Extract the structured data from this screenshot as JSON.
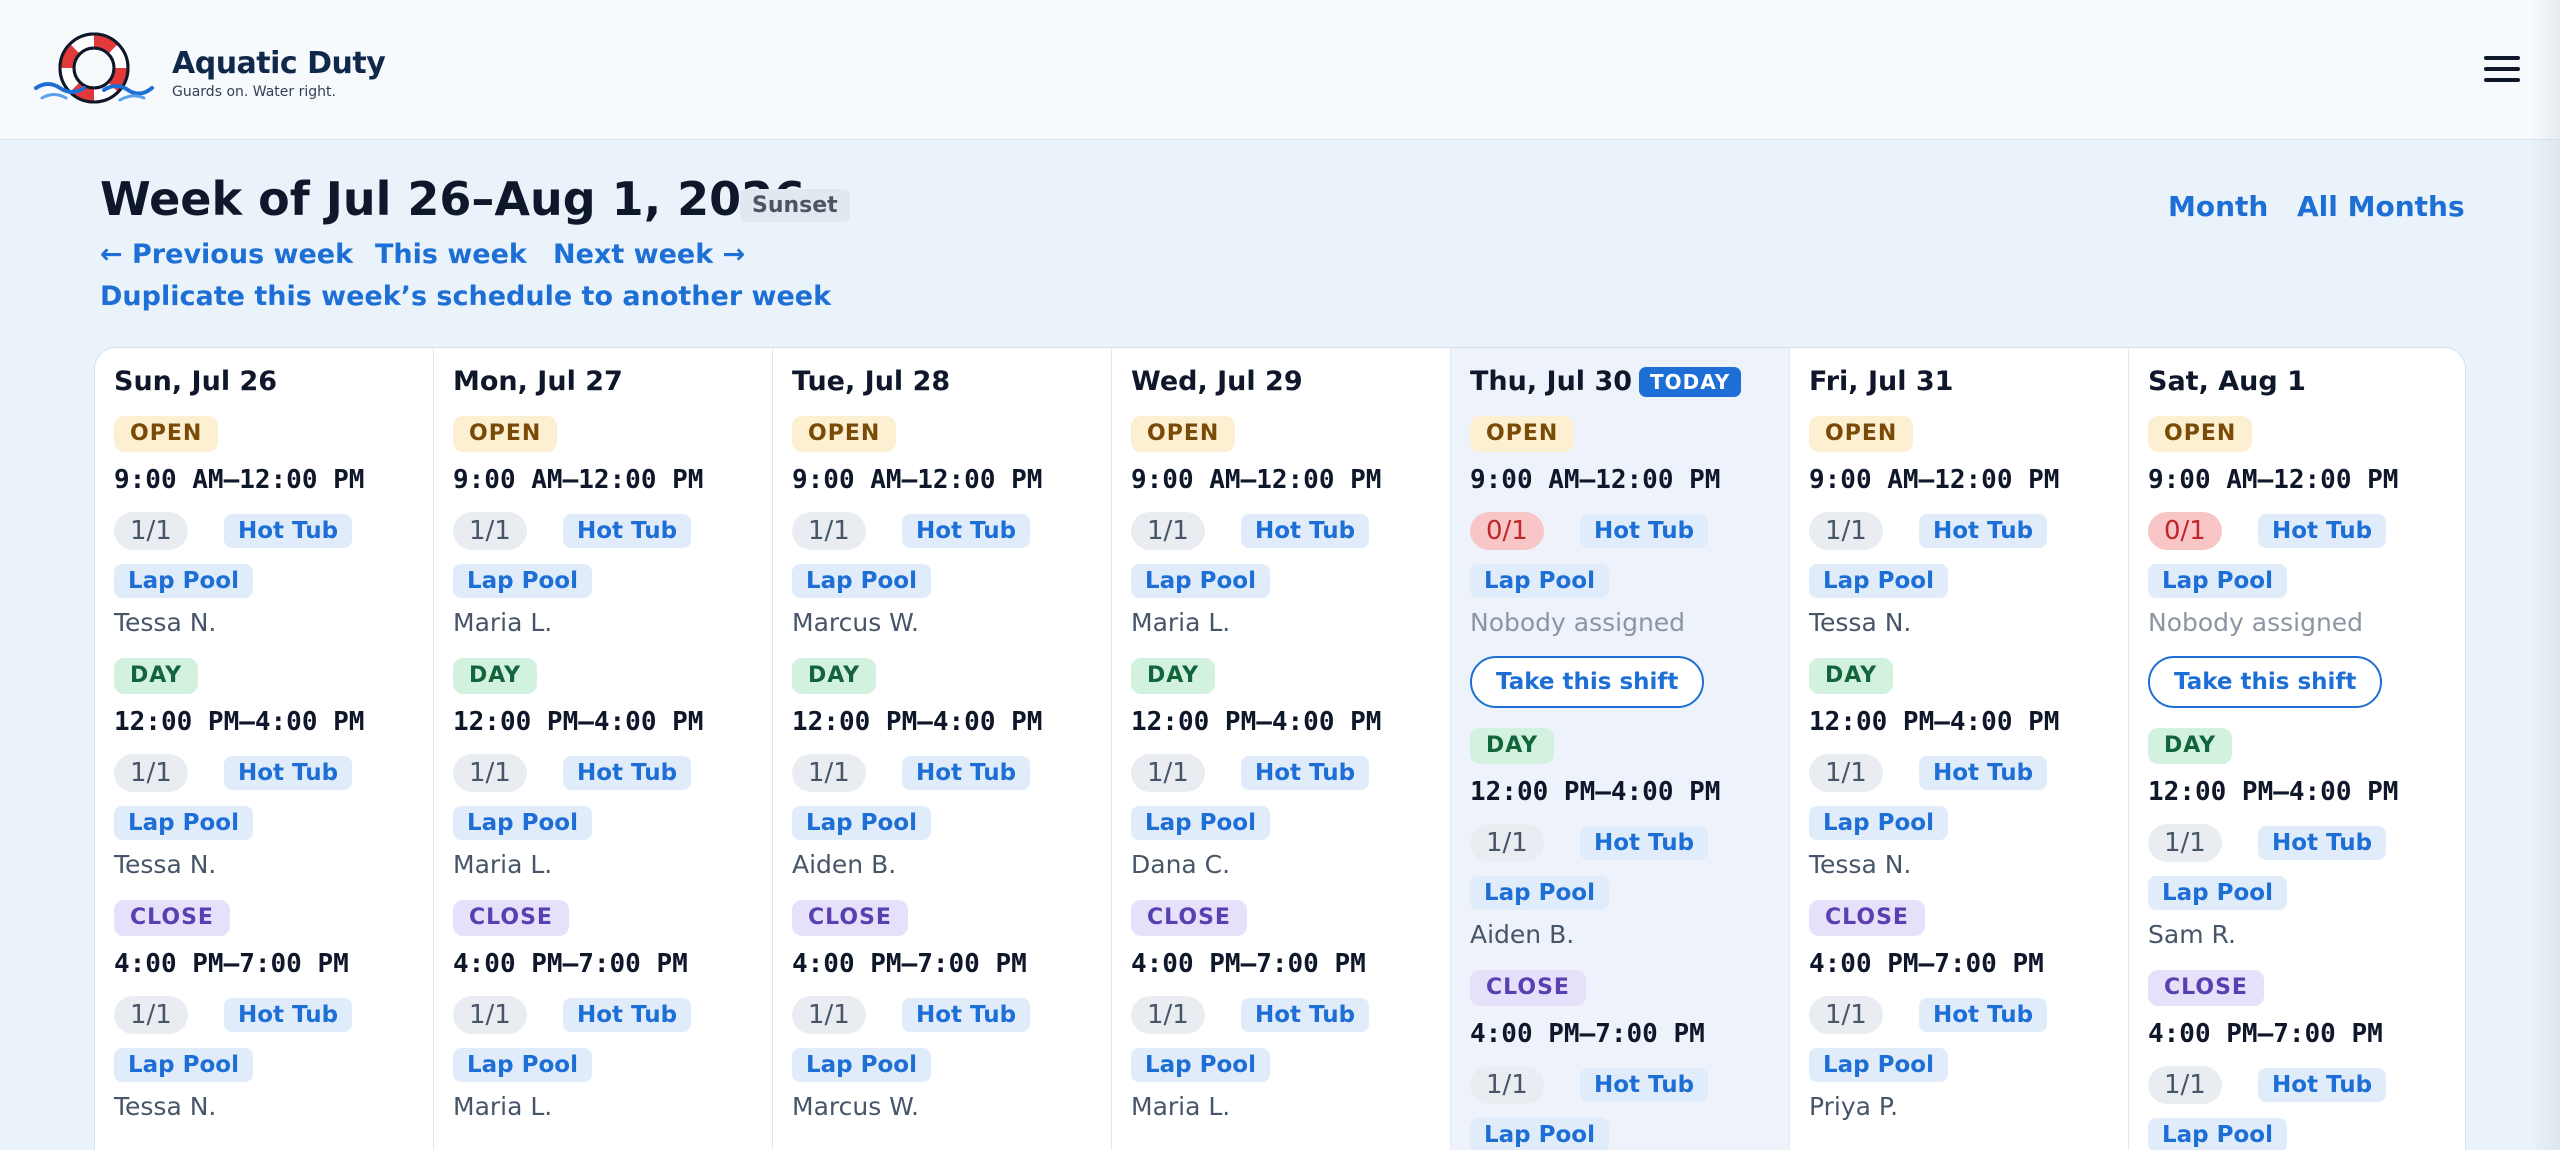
{
  "brand": {
    "name": "Aquatic Duty",
    "tagline": "Guards on. Water right."
  },
  "menu_icon": "hamburger-icon",
  "week": {
    "title": "Week of Jul 26–Aug 1, 2026",
    "badge": "Sunset",
    "views": [
      "Month",
      "All Months"
    ],
    "nav": {
      "prev": "← Previous week",
      "this": "This week",
      "next": "Next week →"
    },
    "duplicate": "Duplicate this week’s schedule to another week"
  },
  "colors": {
    "accent": "#1d6fd6",
    "today_bg": "#eef3fb",
    "short_staffed": "#c0262d"
  },
  "today_label": "TODAY",
  "take_label": "Take this shift",
  "days": [
    {
      "label": "Sun, Jul 26",
      "today": false,
      "shifts": [
        {
          "tag": "OPEN",
          "kind": "open",
          "time": "9:00 AM–12:00 PM",
          "count": "1/1",
          "locations": [
            "Hot Tub",
            "Lap Pool"
          ],
          "assignee": "Tessa N."
        },
        {
          "tag": "DAY",
          "kind": "day",
          "time": "12:00 PM–4:00 PM",
          "count": "1/1",
          "locations": [
            "Hot Tub",
            "Lap Pool"
          ],
          "assignee": "Tessa N."
        },
        {
          "tag": "CLOSE",
          "kind": "close",
          "time": "4:00 PM–7:00 PM",
          "count": "1/1",
          "locations": [
            "Hot Tub",
            "Lap Pool"
          ],
          "assignee": "Tessa N."
        }
      ]
    },
    {
      "label": "Mon, Jul 27",
      "today": false,
      "shifts": [
        {
          "tag": "OPEN",
          "kind": "open",
          "time": "9:00 AM–12:00 PM",
          "count": "1/1",
          "locations": [
            "Hot Tub",
            "Lap Pool"
          ],
          "assignee": "Maria L."
        },
        {
          "tag": "DAY",
          "kind": "day",
          "time": "12:00 PM–4:00 PM",
          "count": "1/1",
          "locations": [
            "Hot Tub",
            "Lap Pool"
          ],
          "assignee": "Maria L."
        },
        {
          "tag": "CLOSE",
          "kind": "close",
          "time": "4:00 PM–7:00 PM",
          "count": "1/1",
          "locations": [
            "Hot Tub",
            "Lap Pool"
          ],
          "assignee": "Maria L."
        }
      ]
    },
    {
      "label": "Tue, Jul 28",
      "today": false,
      "shifts": [
        {
          "tag": "OPEN",
          "kind": "open",
          "time": "9:00 AM–12:00 PM",
          "count": "1/1",
          "locations": [
            "Hot Tub",
            "Lap Pool"
          ],
          "assignee": "Marcus W."
        },
        {
          "tag": "DAY",
          "kind": "day",
          "time": "12:00 PM–4:00 PM",
          "count": "1/1",
          "locations": [
            "Hot Tub",
            "Lap Pool"
          ],
          "assignee": "Aiden B."
        },
        {
          "tag": "CLOSE",
          "kind": "close",
          "time": "4:00 PM–7:00 PM",
          "count": "1/1",
          "locations": [
            "Hot Tub",
            "Lap Pool"
          ],
          "assignee": "Marcus W."
        }
      ]
    },
    {
      "label": "Wed, Jul 29",
      "today": false,
      "shifts": [
        {
          "tag": "OPEN",
          "kind": "open",
          "time": "9:00 AM–12:00 PM",
          "count": "1/1",
          "locations": [
            "Hot Tub",
            "Lap Pool"
          ],
          "assignee": "Maria L."
        },
        {
          "tag": "DAY",
          "kind": "day",
          "time": "12:00 PM–4:00 PM",
          "count": "1/1",
          "locations": [
            "Hot Tub",
            "Lap Pool"
          ],
          "assignee": "Dana C."
        },
        {
          "tag": "CLOSE",
          "kind": "close",
          "time": "4:00 PM–7:00 PM",
          "count": "1/1",
          "locations": [
            "Hot Tub",
            "Lap Pool"
          ],
          "assignee": "Maria L."
        }
      ]
    },
    {
      "label": "Thu, Jul 30",
      "today": true,
      "shifts": [
        {
          "tag": "OPEN",
          "kind": "open",
          "time": "9:00 AM–12:00 PM",
          "count": "0/1",
          "locations": [
            "Hot Tub",
            "Lap Pool"
          ],
          "assignee": "Nobody assigned",
          "unfilled": true
        },
        {
          "tag": "DAY",
          "kind": "day",
          "time": "12:00 PM–4:00 PM",
          "count": "1/1",
          "locations": [
            "Hot Tub",
            "Lap Pool"
          ],
          "assignee": "Aiden B."
        },
        {
          "tag": "CLOSE",
          "kind": "close",
          "time": "4:00 PM–7:00 PM",
          "count": "1/1",
          "locations": [
            "Hot Tub",
            "Lap Pool"
          ],
          "assignee": ""
        }
      ]
    },
    {
      "label": "Fri, Jul 31",
      "today": false,
      "shifts": [
        {
          "tag": "OPEN",
          "kind": "open",
          "time": "9:00 AM–12:00 PM",
          "count": "1/1",
          "locations": [
            "Hot Tub",
            "Lap Pool"
          ],
          "assignee": "Tessa N."
        },
        {
          "tag": "DAY",
          "kind": "day",
          "time": "12:00 PM–4:00 PM",
          "count": "1/1",
          "locations": [
            "Hot Tub",
            "Lap Pool"
          ],
          "assignee": "Tessa N."
        },
        {
          "tag": "CLOSE",
          "kind": "close",
          "time": "4:00 PM–7:00 PM",
          "count": "1/1",
          "locations": [
            "Hot Tub",
            "Lap Pool"
          ],
          "assignee": "Priya P."
        }
      ]
    },
    {
      "label": "Sat, Aug 1",
      "today": false,
      "shifts": [
        {
          "tag": "OPEN",
          "kind": "open",
          "time": "9:00 AM–12:00 PM",
          "count": "0/1",
          "locations": [
            "Hot Tub",
            "Lap Pool"
          ],
          "assignee": "Nobody assigned",
          "unfilled": true
        },
        {
          "tag": "DAY",
          "kind": "day",
          "time": "12:00 PM–4:00 PM",
          "count": "1/1",
          "locations": [
            "Hot Tub",
            "Lap Pool"
          ],
          "assignee": "Sam R."
        },
        {
          "tag": "CLOSE",
          "kind": "close",
          "time": "4:00 PM–7:00 PM",
          "count": "1/1",
          "locations": [
            "Hot Tub",
            "Lap Pool"
          ],
          "assignee": ""
        }
      ]
    }
  ]
}
